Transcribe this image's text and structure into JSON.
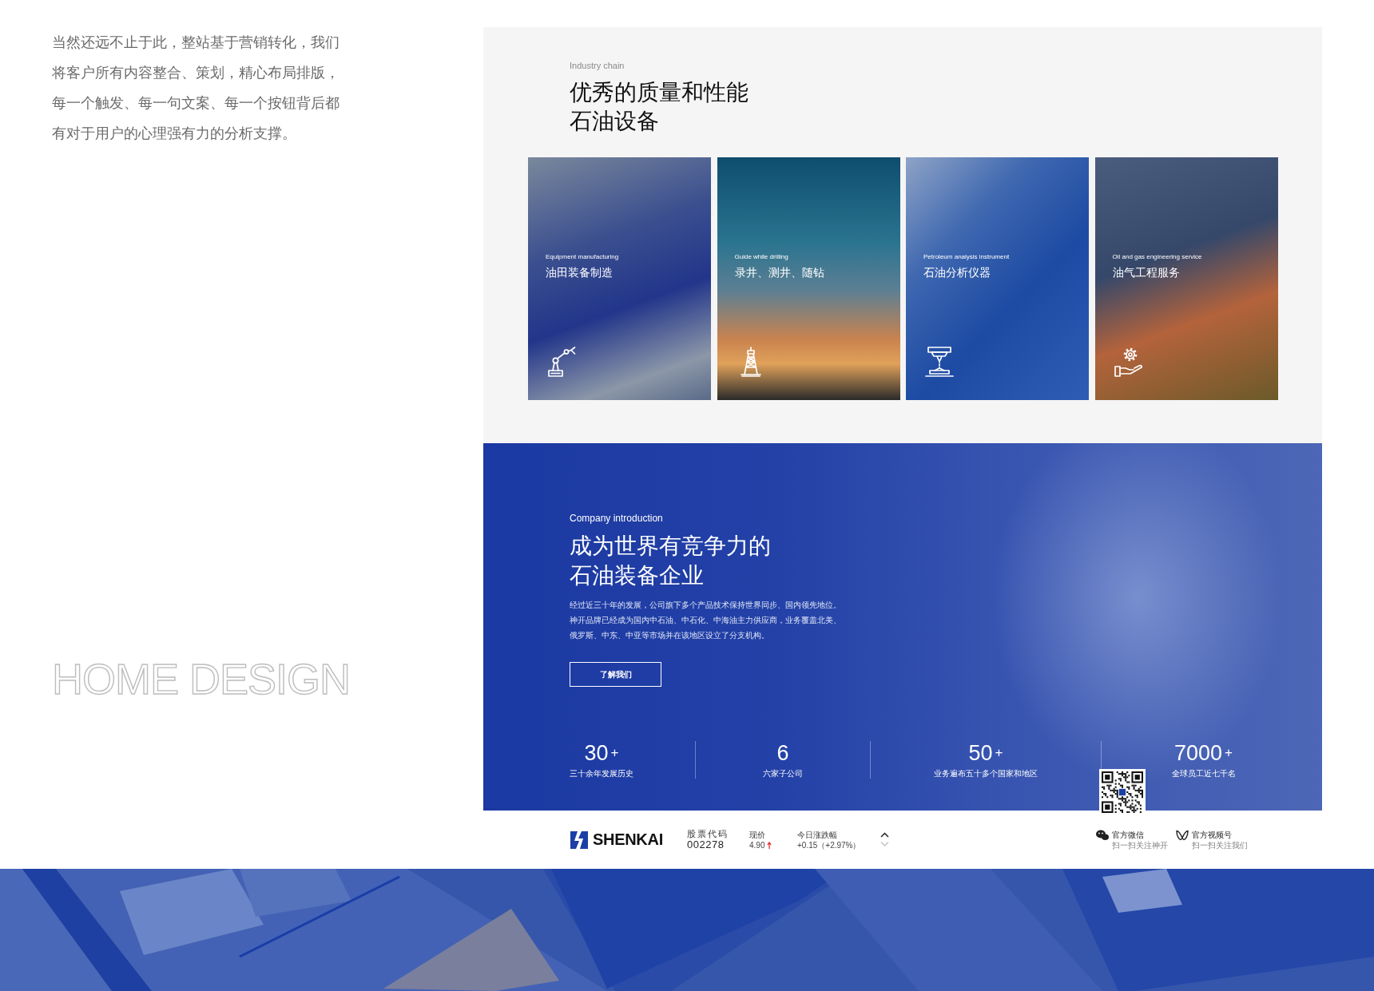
{
  "intro_note": {
    "lines": [
      "当然还远不止于此，整站基于营销转化，我们",
      "将客户所有内容整合、策划，精心布局排版，",
      "每一个触发、每一句文案、每一个按钮背后都",
      "有对于用户的心理强有力的分析支撑。"
    ]
  },
  "showcase_title": "HOME DESIGN",
  "industry": {
    "eyebrow": "Industry chain",
    "title_lines": [
      "优秀的质量和性能",
      "石油设备"
    ],
    "cards": [
      {
        "subtitle": "Equipment manufacturing",
        "title": "油田装备制造"
      },
      {
        "subtitle": "Guide while drilling",
        "title": "录井、测井、随钻"
      },
      {
        "subtitle": "Petroleum analysis instrument",
        "title": "石油分析仪器"
      },
      {
        "subtitle": "Oil and gas engineering service",
        "title": "油气工程服务"
      }
    ]
  },
  "company": {
    "eyebrow": "Company introduction",
    "title_lines": [
      "成为世界有竞争力的",
      "石油装备企业"
    ],
    "body_lines": [
      "经过近三十年的发展，公司旗下多个产品技术保持世界同步、国内领先地位。",
      "神开品牌已经成为国内中石油、中石化、中海油主力供应商，业务覆盖北美、",
      "俄罗斯、中东、中亚等市场并在该地区设立了分支机构。"
    ],
    "button": "了解我们",
    "stats": [
      {
        "value": "30",
        "suffix": "+",
        "label": "三十余年发展历史"
      },
      {
        "value": "6",
        "label": "六家子公司"
      },
      {
        "value": "50",
        "suffix": "+",
        "label": "业务遍布五十多个国家和地区"
      },
      {
        "value": "7000",
        "suffix": "+",
        "label": "全球员工近七千名"
      }
    ]
  },
  "footer": {
    "brand": "SHENKAI",
    "stock": {
      "label": "股票代码",
      "value": "002278"
    },
    "price": {
      "label": "现价",
      "value": "4.90",
      "rising": true
    },
    "change": {
      "label": "今日涨跌幅",
      "value": "+0.15（+2.97%）"
    },
    "pager": [
      {
        "kind": "up",
        "disabled": false
      },
      {
        "kind": "down",
        "disabled": true
      }
    ],
    "social": [
      {
        "kind": "wechat",
        "label": "官方微信",
        "hint": "扫一扫关注神开",
        "qr_shown": true
      },
      {
        "kind": "video",
        "label": "官方视频号",
        "hint": "扫一扫关注我们",
        "qr_shown": false
      }
    ]
  }
}
